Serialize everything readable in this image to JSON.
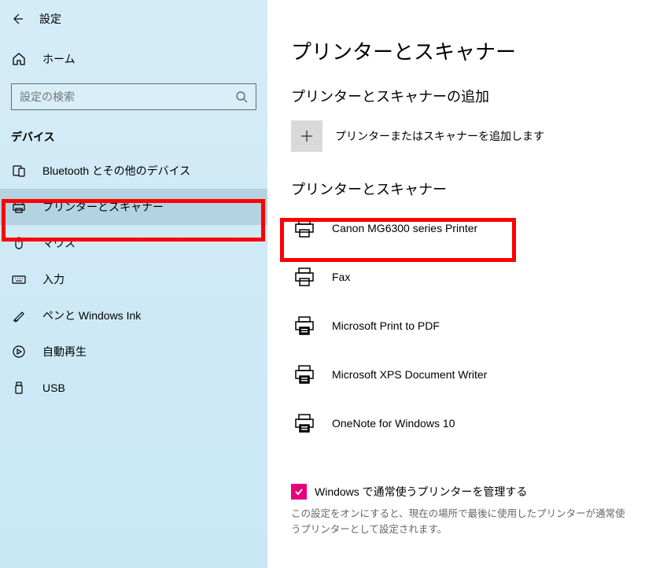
{
  "header": {
    "title": "設定"
  },
  "sidebar": {
    "home": "ホーム",
    "search_placeholder": "設定の検索",
    "category": "デバイス",
    "items": [
      {
        "label": "Bluetooth とその他のデバイス"
      },
      {
        "label": "プリンターとスキャナー"
      },
      {
        "label": "マウス"
      },
      {
        "label": "入力"
      },
      {
        "label": "ペンと Windows Ink"
      },
      {
        "label": "自動再生"
      },
      {
        "label": "USB"
      }
    ]
  },
  "main": {
    "title": "プリンターとスキャナー",
    "add_header": "プリンターとスキャナーの追加",
    "add_label": "プリンターまたはスキャナーを追加します",
    "list_header": "プリンターとスキャナー",
    "devices": [
      {
        "name": "Canon MG6300 series Printer"
      },
      {
        "name": "Fax"
      },
      {
        "name": "Microsoft Print to PDF"
      },
      {
        "name": "Microsoft XPS Document Writer"
      },
      {
        "name": "OneNote for Windows 10"
      }
    ],
    "manage_checkbox": "Windows で通常使うプリンターを管理する",
    "manage_desc": "この設定をオンにすると、現在の場所で最後に使用したプリンターが通常使うプリンターとして設定されます。"
  }
}
